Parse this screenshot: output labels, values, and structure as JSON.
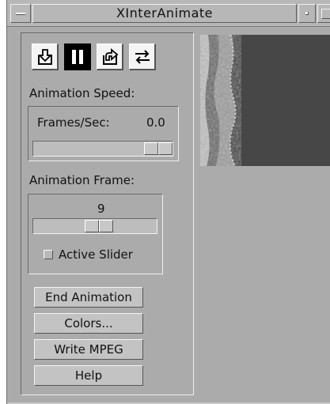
{
  "window": {
    "title": "XInterAnimate"
  },
  "toolbar": {
    "buttons": [
      {
        "name": "step-backward",
        "icon": "step-backward-icon"
      },
      {
        "name": "pause",
        "icon": "pause-icon",
        "active": true
      },
      {
        "name": "step-forward",
        "icon": "step-forward-icon"
      },
      {
        "name": "loop",
        "icon": "loop-icon"
      }
    ]
  },
  "speed": {
    "heading": "Animation Speed:",
    "frames_label": "Frames/Sec:",
    "frames_value": "0.0",
    "slider_fraction": 0.92
  },
  "frame": {
    "heading": "Animation Frame:",
    "value": "9",
    "slider_fraction": 0.53,
    "active_slider_label": "Active Slider",
    "active_slider_checked": false
  },
  "actions": {
    "end_animation": "End Animation",
    "colors": "Colors...",
    "write_mpeg": "Write MPEG",
    "help": "Help"
  },
  "colors": {
    "window_bg": "#ababab",
    "image_bg": "#474747",
    "image_edge": "#b0b0b0"
  }
}
